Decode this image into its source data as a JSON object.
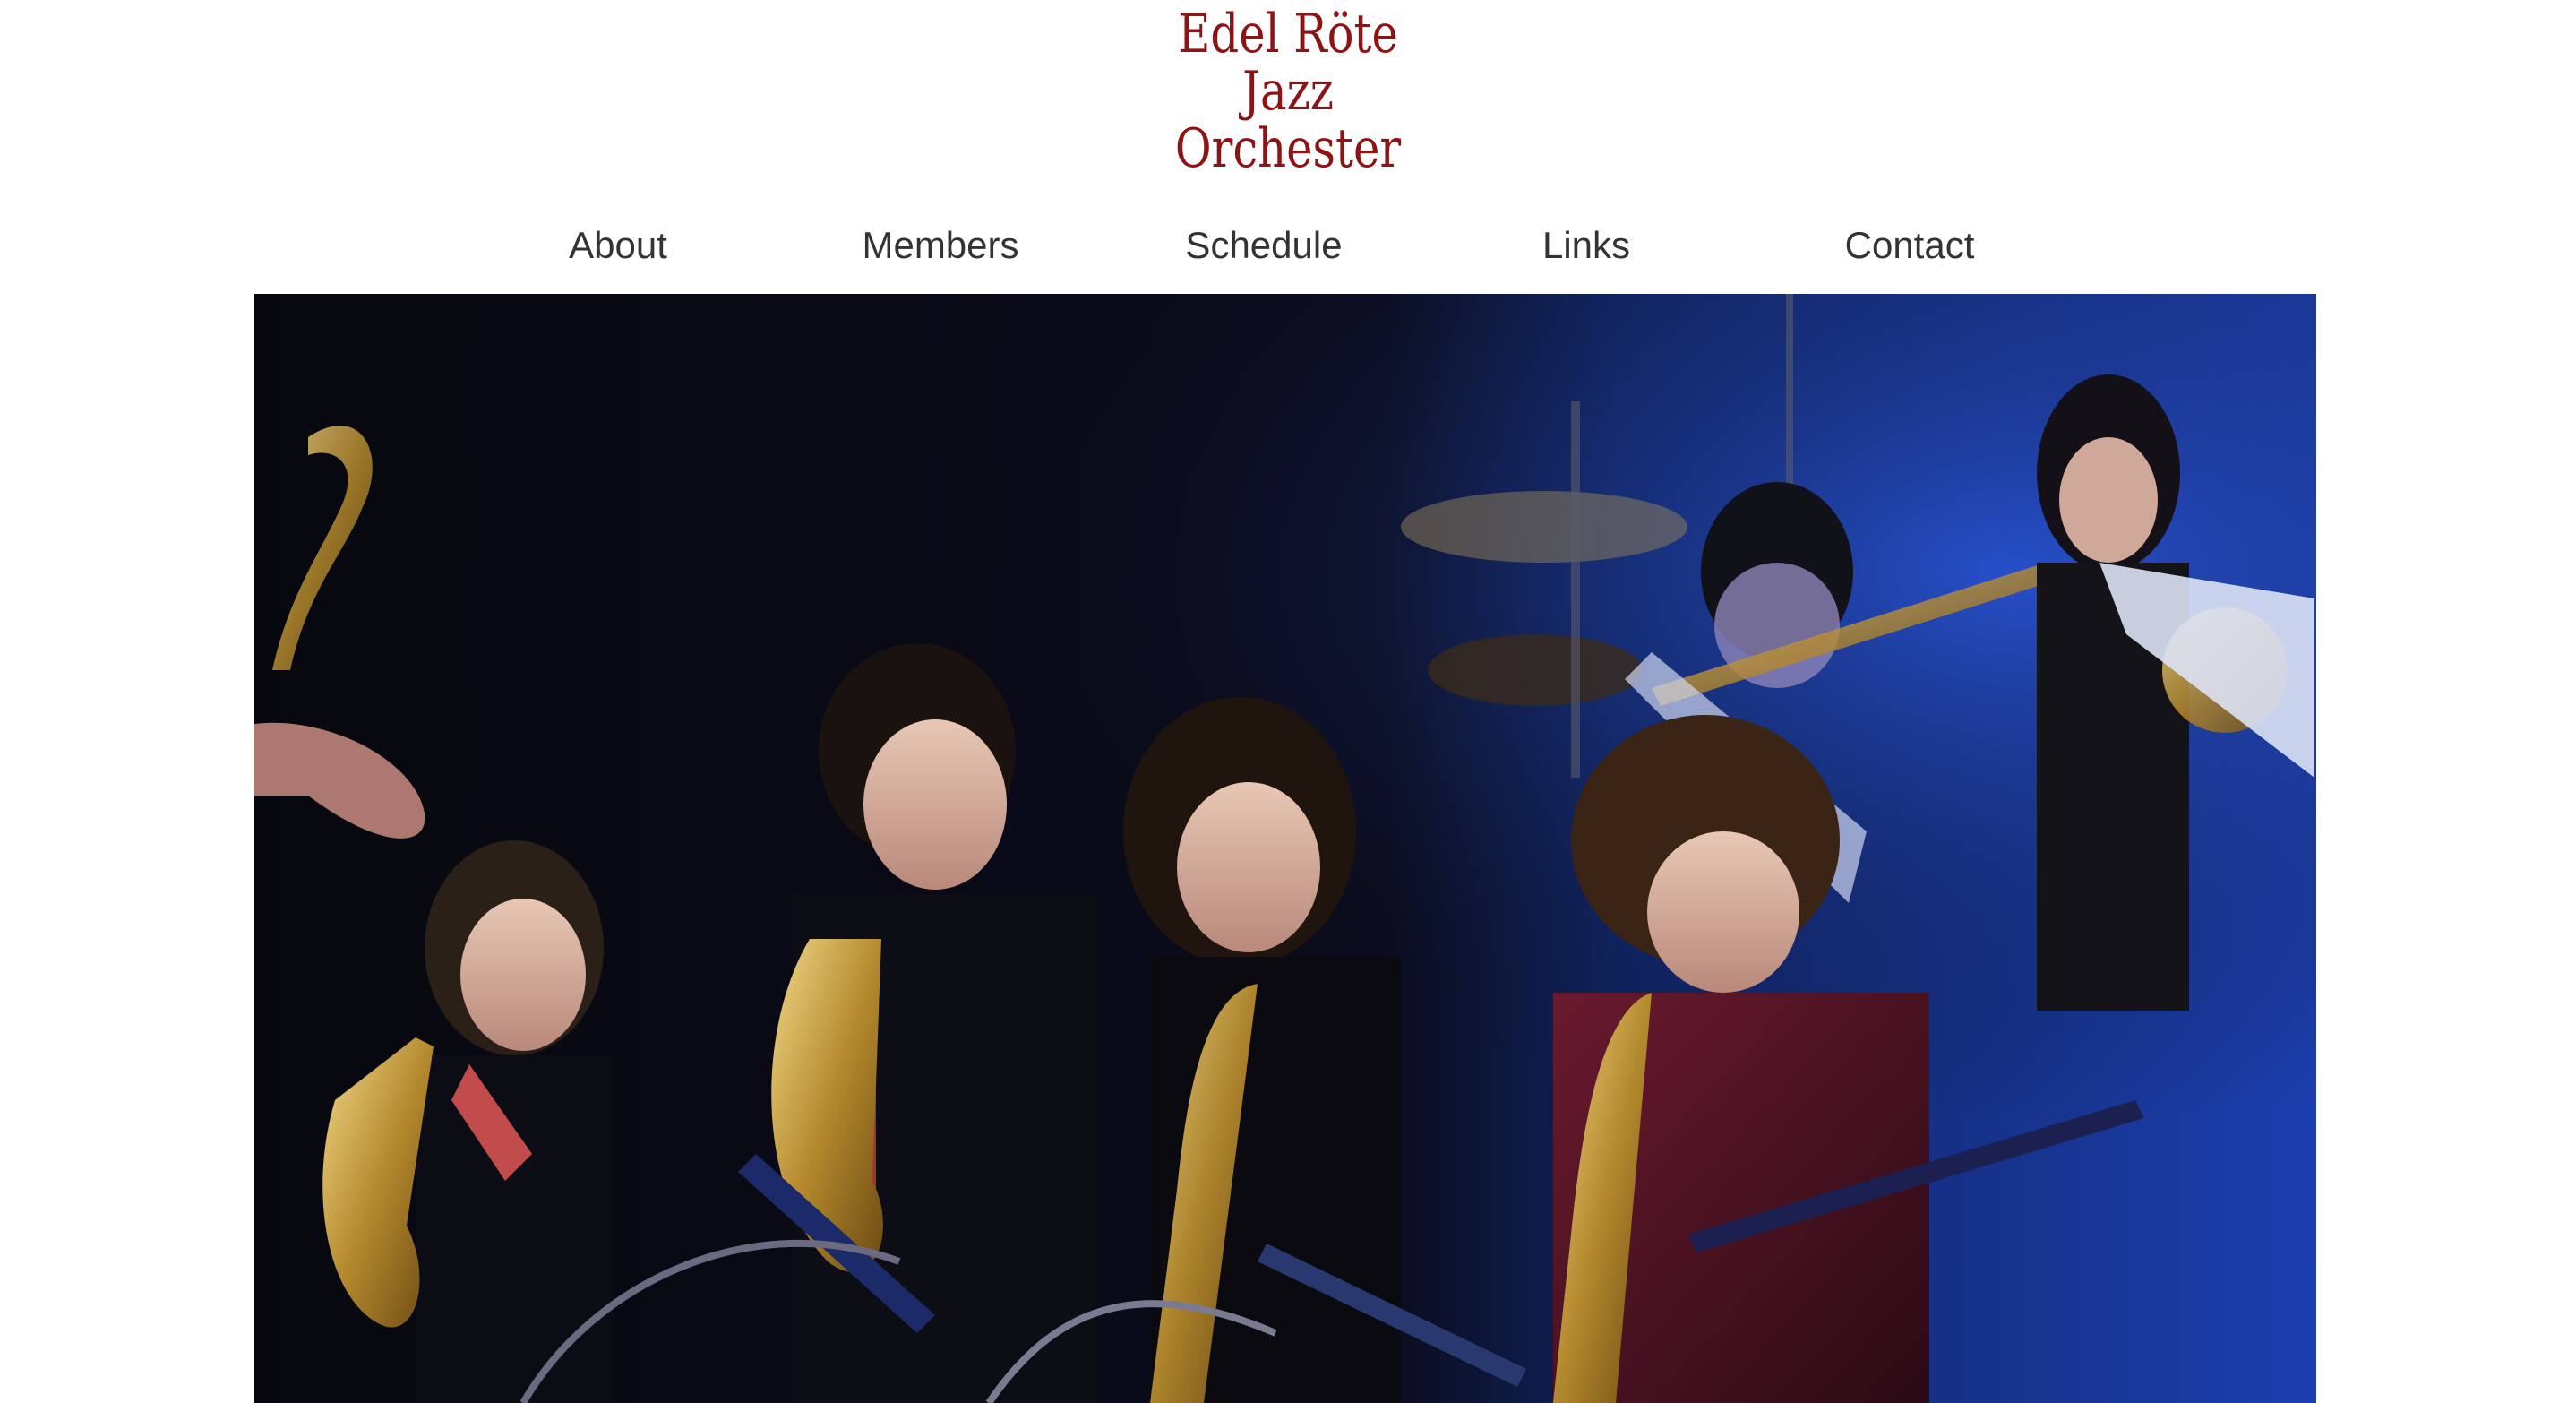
{
  "site": {
    "logo_lines": [
      "Edel Röte",
      "Jazz",
      "Orchester"
    ],
    "logo_color": "#8c1414"
  },
  "nav": {
    "items": [
      {
        "label": "About"
      },
      {
        "label": "Members"
      },
      {
        "label": "Schedule"
      },
      {
        "label": "Links"
      },
      {
        "label": "Contact"
      }
    ]
  },
  "hero": {
    "image": "jazz-orchestra-saxophone-section-photo"
  }
}
